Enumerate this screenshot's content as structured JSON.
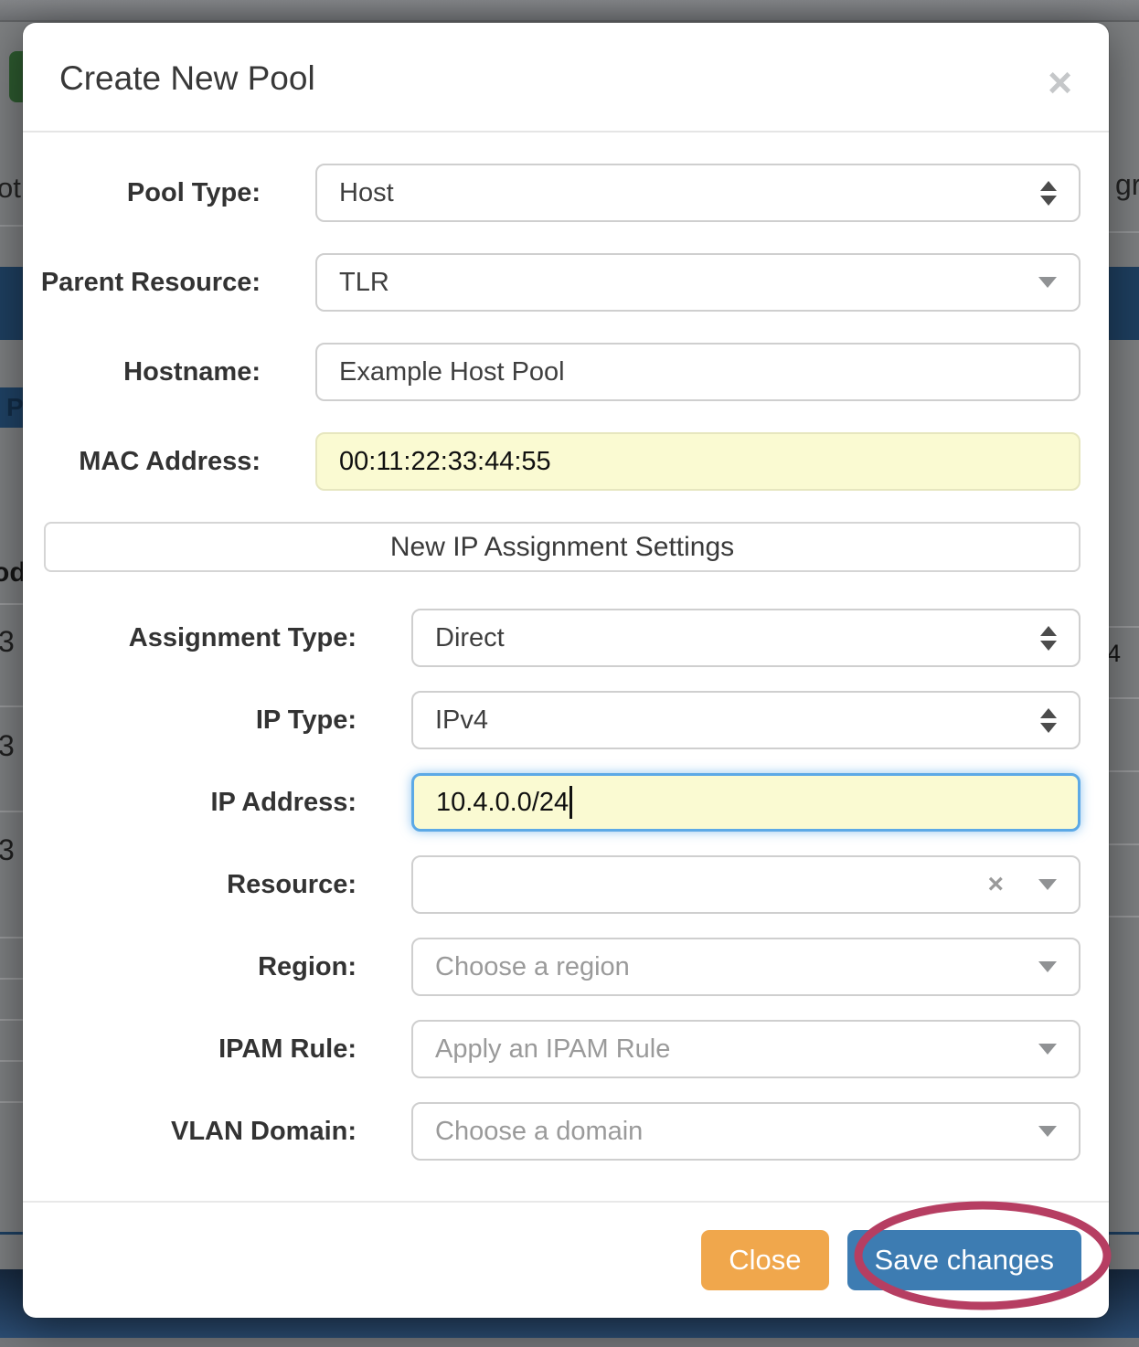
{
  "modal": {
    "title": "Create New Pool",
    "close_icon": "×",
    "section_header": "New IP Assignment Settings",
    "footer": {
      "close_label": "Close",
      "save_label": "Save changes"
    }
  },
  "form": {
    "pool_type": {
      "label": "Pool Type:",
      "value": "Host"
    },
    "parent_resource": {
      "label": "Parent Resource:",
      "value": "TLR"
    },
    "hostname": {
      "label": "Hostname:",
      "value": "Example Host Pool"
    },
    "mac_address": {
      "label": "MAC Address:",
      "value": "00:11:22:33:44:55"
    },
    "assignment_type": {
      "label": "Assignment Type:",
      "value": "Direct"
    },
    "ip_type": {
      "label": "IP Type:",
      "value": "IPv4"
    },
    "ip_address": {
      "label": "IP Address:",
      "value": "10.4.0.0/24"
    },
    "resource": {
      "label": "Resource:",
      "value": "",
      "clear_icon": "×"
    },
    "region": {
      "label": "Region:",
      "placeholder": "Choose a region"
    },
    "ipam_rule": {
      "label": "IPAM Rule:",
      "placeholder": "Apply an IPAM Rule"
    },
    "vlan_domain": {
      "label": "VLAN Domain:",
      "placeholder": "Choose a domain"
    }
  },
  "backdrop": {
    "left_text": "ot",
    "right_text": "gr",
    "tab_letter": "P",
    "table_header_fragment": "od",
    "left_rows": {
      "r1": "3",
      "r2": "3",
      "r3": "3"
    },
    "right_row_fragment": "4"
  },
  "colors": {
    "overlay-gray": "#7d7f81",
    "navy": "#1e3f60",
    "footer-navy-dark": "#17293f",
    "footer-navy-light": "#2b4c72",
    "green": "#2d5a2f",
    "field-yellow": "#fafad2",
    "focus-blue": "#5ca9e6",
    "close-orange": "#f0a74c",
    "save-blue": "#3d7cb2",
    "annotation-pink": "#b63e62"
  }
}
